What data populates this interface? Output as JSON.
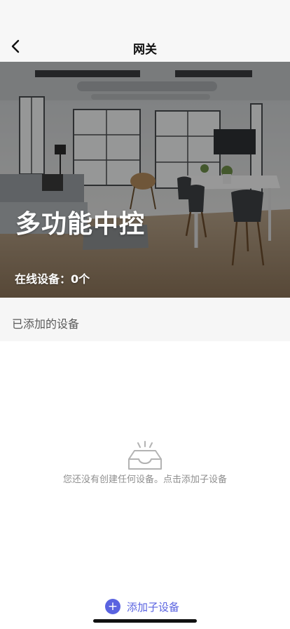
{
  "nav": {
    "title": "网关",
    "back_icon": "chevron-left-icon"
  },
  "hero": {
    "title": "多功能中控",
    "online_label": "在线设备：0个"
  },
  "section": {
    "title": "已添加的设备"
  },
  "empty": {
    "icon": "empty-tray-icon",
    "message": "您还没有创建任何设备。点击添加子设备"
  },
  "actions": {
    "add_label": "添加子设备",
    "add_icon": "plus-circle-icon",
    "accent": "#5a63e0"
  }
}
